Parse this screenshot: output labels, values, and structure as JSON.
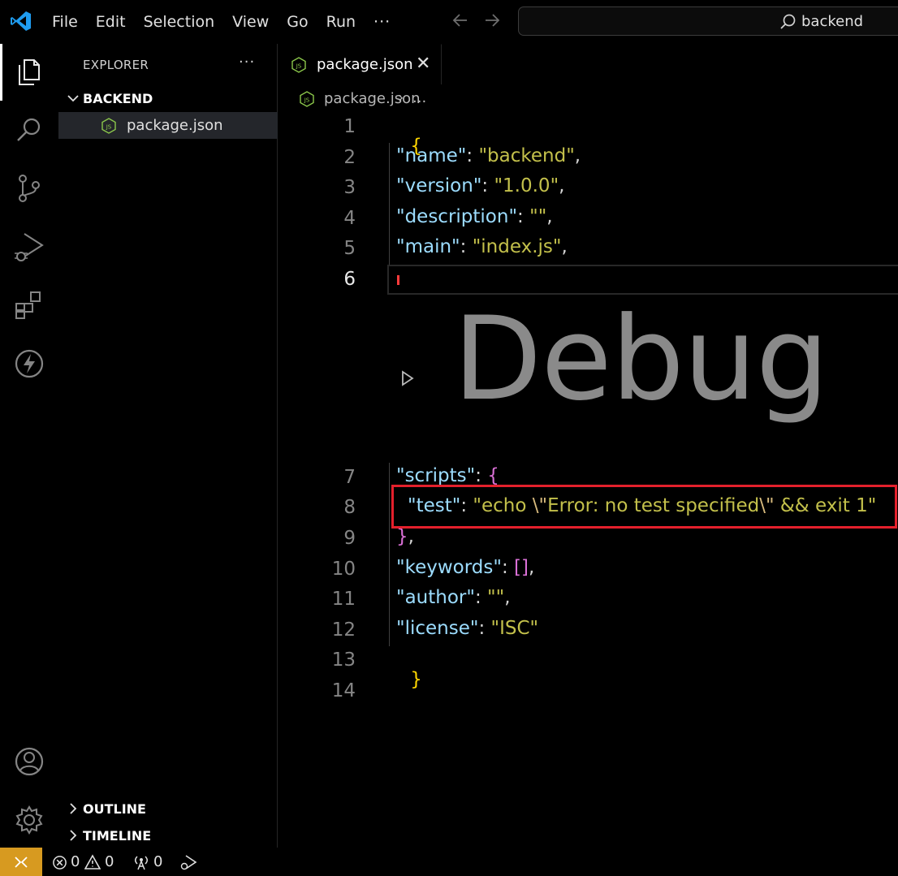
{
  "titlebar": {
    "menu": [
      "File",
      "Edit",
      "Selection",
      "View",
      "Go",
      "Run"
    ],
    "menu_more": "···",
    "search_text": "backend"
  },
  "sidebar": {
    "title": "EXPLORER",
    "more": "···",
    "folder": "BACKEND",
    "file": "package.json",
    "outline": "OUTLINE",
    "timeline": "TIMELINE"
  },
  "editor": {
    "tab_label": "package.json",
    "tab_close": "✕",
    "breadcrumb_file": "package.json",
    "breadcrumb_sep": "›",
    "breadcrumb_more": "...",
    "line_numbers": [
      "1",
      "2",
      "3",
      "4",
      "5",
      "6",
      "7",
      "8",
      "9",
      "10",
      "11",
      "12",
      "13",
      "14"
    ],
    "debug_overlay": "Debug",
    "lines": {
      "l1": "{",
      "l2_key": "\"name\"",
      "l2_colon": ": ",
      "l2_val": "\"backend\"",
      "l2_comma": ",",
      "l3_key": "\"version\"",
      "l3_colon": ": ",
      "l3_val": "\"1.0.0\"",
      "l3_comma": ",",
      "l4_key": "\"description\"",
      "l4_colon": ": ",
      "l4_val": "\"\"",
      "l4_comma": ",",
      "l5_key": "\"main\"",
      "l5_colon": ": ",
      "l5_val": "\"index.js\"",
      "l5_comma": ",",
      "l7_key": "\"scripts\"",
      "l7_colon": ": ",
      "l7_brace": "{",
      "l8_key": "\"test\"",
      "l8_colon": ": ",
      "l8_q1": "\"echo ",
      "l8_esc1": "\\\"",
      "l8_mid": "Error: no test specified",
      "l8_esc2": "\\\"",
      "l8_end": " && exit 1\"",
      "l9_brace": "}",
      "l9_comma": ",",
      "l10_key": "\"keywords\"",
      "l10_colon": ": ",
      "l10_val": "[]",
      "l10_comma": ",",
      "l11_key": "\"author\"",
      "l11_colon": ": ",
      "l11_val": "\"\"",
      "l11_comma": ",",
      "l12_key": "\"license\"",
      "l12_colon": ": ",
      "l12_val": "\"ISC\"",
      "l13": "}"
    }
  },
  "statusbar": {
    "errors": "0",
    "warnings": "0",
    "ports": "0"
  },
  "colors": {
    "remote": "#d79a20",
    "highlight": "#e4202c",
    "json_key": "#9cdcfe",
    "json_string": "#c3c04b",
    "brace": "#ffd700"
  }
}
